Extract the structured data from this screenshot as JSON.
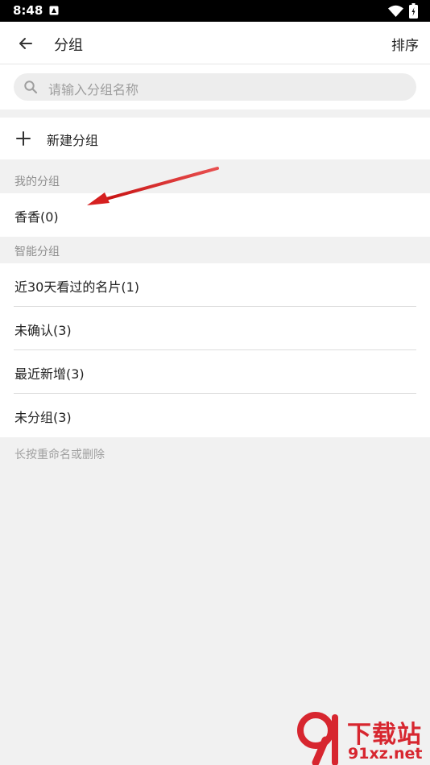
{
  "status_bar": {
    "time": "8:48"
  },
  "app_bar": {
    "title": "分组",
    "sort_label": "排序"
  },
  "search": {
    "placeholder": "请输入分组名称"
  },
  "new_group": {
    "label": "新建分组"
  },
  "my_groups": {
    "header": "我的分组",
    "items": [
      {
        "label": "香香(0)"
      }
    ]
  },
  "smart_groups": {
    "header": "智能分组",
    "items": [
      {
        "label": "近30天看过的名片(1)"
      },
      {
        "label": "未确认(3)"
      },
      {
        "label": "最近新增(3)"
      },
      {
        "label": "未分组(3)"
      }
    ]
  },
  "hint": "长按重命名或删除",
  "watermark": {
    "title": "下载站",
    "domain": "91xz.net"
  },
  "colors": {
    "annotation_arrow": "#d62020",
    "watermark": "#d7262f"
  }
}
